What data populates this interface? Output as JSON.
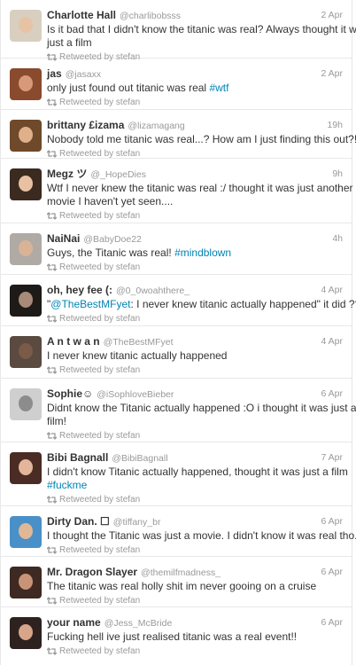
{
  "retweet_label": "Retweeted by stefan",
  "tweets": [
    {
      "name": "Charlotte Hall",
      "handle": "@charlibobsss",
      "time": "2 Apr",
      "lines": [
        {
          "text": "Is it bad that I didn't know the titanic was real? Always thought it was"
        },
        {
          "text": "just a film"
        }
      ]
    },
    {
      "name": "jas",
      "handle": "@jasaxx",
      "time": "2 Apr",
      "lines": [
        {
          "text": "only just found out titanic was real ",
          "link": "#wtf"
        }
      ]
    },
    {
      "name": "brittany £izama",
      "handle": "@lizamagang",
      "time": "19h",
      "lines": [
        {
          "text": "Nobody told me titanic was real...? How am I just finding this out?!"
        }
      ]
    },
    {
      "name": "Megz ツ",
      "handle": "@_HopeDies",
      "time": "9h",
      "lines": [
        {
          "text": "Wtf I never knew the titanic was real :/ thought it was just another"
        },
        {
          "text": "movie I haven't yet seen...."
        }
      ]
    },
    {
      "name": "NaiNai",
      "handle": "@BabyDoe22",
      "time": "4h",
      "lines": [
        {
          "text": "Guys, the Titanic was real! ",
          "link": "#mindblown"
        }
      ]
    },
    {
      "name": "oh, hey fee (:",
      "handle": "@0_0woahthere_",
      "time": "4 Apr",
      "lines": [
        {
          "pre": "\"",
          "link": "@TheBestMFyet",
          "text": ": I never knew titanic actually happened\" it did ???"
        }
      ]
    },
    {
      "name": "A n t w a n",
      "handle": "@TheBestMFyet",
      "time": "4 Apr",
      "lines": [
        {
          "text": "I never knew titanic actually happened"
        }
      ]
    },
    {
      "name": "Sophie☺",
      "handle": "@iSophloveBieber",
      "time": "6 Apr",
      "lines": [
        {
          "text": "Didnt know the Titanic actually happened :O i thought it was just a"
        },
        {
          "text": "film!"
        }
      ]
    },
    {
      "name": "Bibi Bagnall",
      "handle": "@BibiBagnall",
      "time": "7 Apr",
      "lines": [
        {
          "text": "I didn't know Titanic actually happened, thought it was just a film"
        },
        {
          "text": "",
          "link": "#fuckme"
        }
      ]
    },
    {
      "name": "Dirty Dan. ☐",
      "handle": "@tiffany_br",
      "time": "6 Apr",
      "lines": [
        {
          "text": "I thought the Titanic was just a movie. I didn't know it was real tho."
        }
      ]
    },
    {
      "name": "Mr. Dragon Slayer",
      "handle": "@themilfmadness_",
      "time": "6 Apr",
      "lines": [
        {
          "text": "The titanic was real holly shit im never gooing on a cruise"
        }
      ]
    },
    {
      "name": "your name",
      "handle": "@Jess_McBride",
      "time": "6 Apr",
      "lines": [
        {
          "text": "Fucking hell ive just realised titanic was a real event!!"
        }
      ]
    }
  ]
}
